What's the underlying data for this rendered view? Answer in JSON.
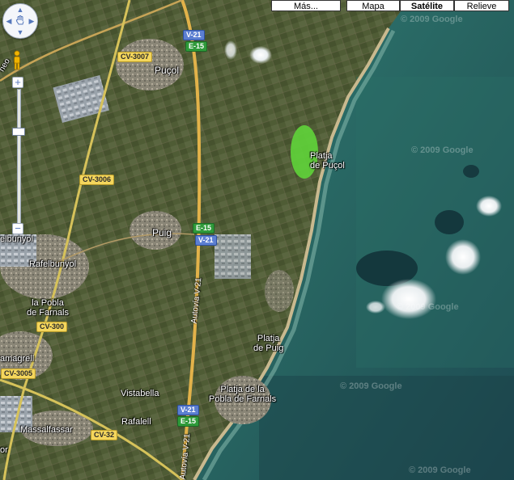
{
  "map_type_buttons": [
    "Más...",
    "Mapa",
    "Satélite",
    "Relieve"
  ],
  "active_map_type": "Satélite",
  "place_labels": {
    "pucol": "Puçol",
    "platja_pucol": "Platja\nde Puçol",
    "puig": "Puig",
    "rafelbunyol": "Rafelbunyol",
    "rafelbunyol_cut": "elbunyol",
    "pobla_farnals": "la Pobla\nde Farnals",
    "platja_puig": "Platja\nde Puig",
    "emagrell": "amagrell",
    "vistabella": "Vistabella",
    "platja_pobla": "Platja de la\nPobla de Farnals",
    "rafalell": "Rafalell",
    "massalfassar": "Massalfassar",
    "or": "or",
    "neo": "neo"
  },
  "road_shields": {
    "cv3007": "CV-3007",
    "cv3006": "CV-3006",
    "cv300": "CV-300",
    "cv3005": "CV-3005",
    "cv32": "CV-32",
    "v21_top": "V-21",
    "e15_top": "E-15",
    "e15_mid": "E-15",
    "v21_mid": "V-21",
    "v21_bot": "V-21",
    "e15_bot": "E-15"
  },
  "road_names": {
    "autovia_mid": "Autovía V-21",
    "autovia_bot": "Autovía V-21"
  },
  "watermark": "© 2009 Google",
  "controls": {
    "zoom_in": "+",
    "zoom_out": "−",
    "pan_up": "▲",
    "pan_down": "▼",
    "pan_left": "◀",
    "pan_right": "▶"
  },
  "colors": {
    "sea": "#2f6a66",
    "sea_deep": "#1f4f55",
    "land": "#4d5a33",
    "beach": "#c9b98f",
    "highway": "#e2b24a",
    "highlight_area": "#5fd13a"
  }
}
